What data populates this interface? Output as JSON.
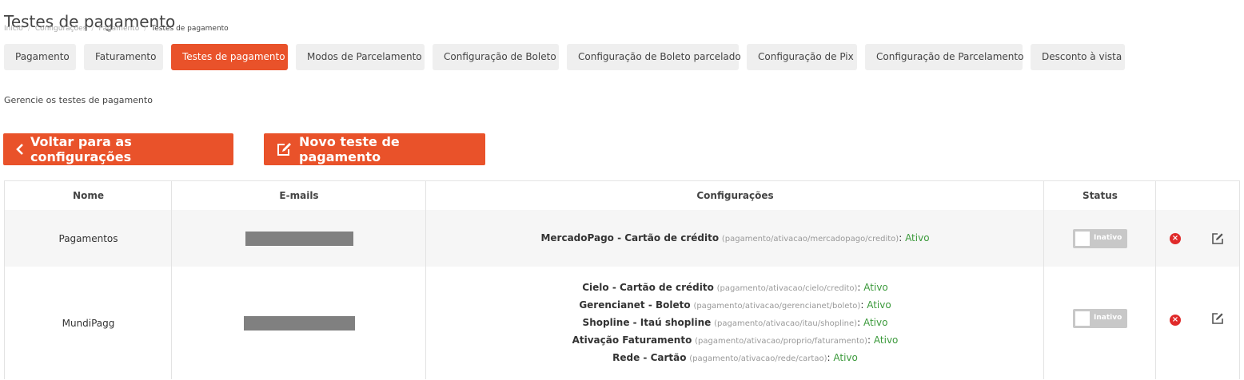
{
  "page": {
    "title": "Testes de pagamento",
    "description": "Gerencie os testes de pagamento"
  },
  "breadcrumb": [
    "Início",
    "Configurações",
    "Pagamento",
    "Testes de pagamento"
  ],
  "tabs": [
    {
      "label": "Pagamento",
      "active": false
    },
    {
      "label": "Faturamento",
      "active": false
    },
    {
      "label": "Testes de pagamento",
      "active": true
    },
    {
      "label": "Modos de Parcelamento",
      "active": false
    },
    {
      "label": "Configuração de Boleto",
      "active": false
    },
    {
      "label": "Configuração de Boleto parcelado",
      "active": false
    },
    {
      "label": "Configuração de Pix",
      "active": false
    },
    {
      "label": "Configuração de Parcelamento",
      "active": false
    },
    {
      "label": "Desconto à vista",
      "active": false
    }
  ],
  "actions": {
    "back_label": "Voltar para as configurações",
    "new_label": "Novo teste de pagamento"
  },
  "table": {
    "headers": {
      "name": "Nome",
      "emails": "E-mails",
      "configs": "Configurações",
      "status": "Status"
    },
    "rows": [
      {
        "name": "Pagamentos",
        "configs": [
          {
            "name": "MercadoPago - Cartão de crédito",
            "path": "(pagamento/ativacao/mercadopago/credito)",
            "status": "Ativo"
          }
        ],
        "status_label": "Inativo"
      },
      {
        "name": "MundiPagg",
        "configs": [
          {
            "name": "Cielo - Cartão de crédito",
            "path": "(pagamento/ativacao/cielo/credito)",
            "status": "Ativo"
          },
          {
            "name": "Gerencianet - Boleto",
            "path": "(pagamento/ativacao/gerencianet/boleto)",
            "status": "Ativo"
          },
          {
            "name": "Shopline - Itaú shopline",
            "path": "(pagamento/ativacao/itau/shopline)",
            "status": "Ativo"
          },
          {
            "name": "Ativação Faturamento",
            "path": "(pagamento/ativacao/proprio/faturamento)",
            "status": "Ativo"
          },
          {
            "name": "Rede - Cartão",
            "path": "(pagamento/ativacao/rede/cartao)",
            "status": "Ativo"
          }
        ],
        "status_label": "Inativo"
      }
    ]
  },
  "colors": {
    "accent": "#e9522a",
    "active_status": "#3c9a3c",
    "delete": "#e02a2a"
  }
}
